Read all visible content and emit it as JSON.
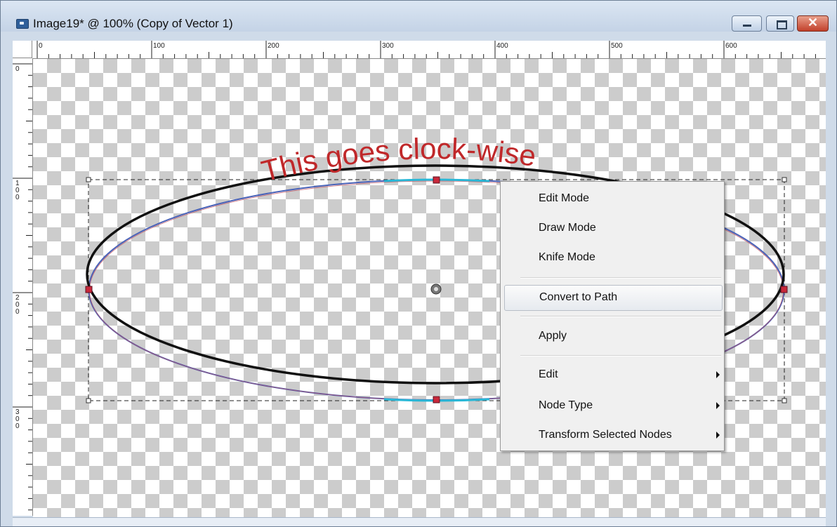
{
  "window": {
    "title": "Image19* @ 100% (Copy of Vector 1)",
    "close_glyph": "✕"
  },
  "canvas": {
    "text_on_path": "This goes clock-wise",
    "text_color": "#c0282a"
  },
  "rulers": {
    "top_labels": [
      "0",
      "100",
      "200",
      "300",
      "400",
      "500",
      "600"
    ],
    "left_labels": [
      "0",
      "100",
      "200",
      "300"
    ]
  },
  "context_menu": {
    "items": [
      {
        "label": "Edit Mode"
      },
      {
        "label": "Draw Mode"
      },
      {
        "label": "Knife Mode"
      },
      {
        "label": "Convert to Path",
        "highlighted": true
      },
      {
        "label": "Apply"
      },
      {
        "label": "Edit",
        "submenu": true
      },
      {
        "label": "Node Type",
        "submenu": true
      },
      {
        "label": "Transform Selected Nodes",
        "submenu": true
      }
    ]
  },
  "icons": {
    "app": "image-document-icon",
    "minimize": "minimize-icon",
    "maximize": "maximize-icon",
    "close": "close-icon",
    "submenu": "chevron-right-icon",
    "center": "crosshair-icon"
  }
}
